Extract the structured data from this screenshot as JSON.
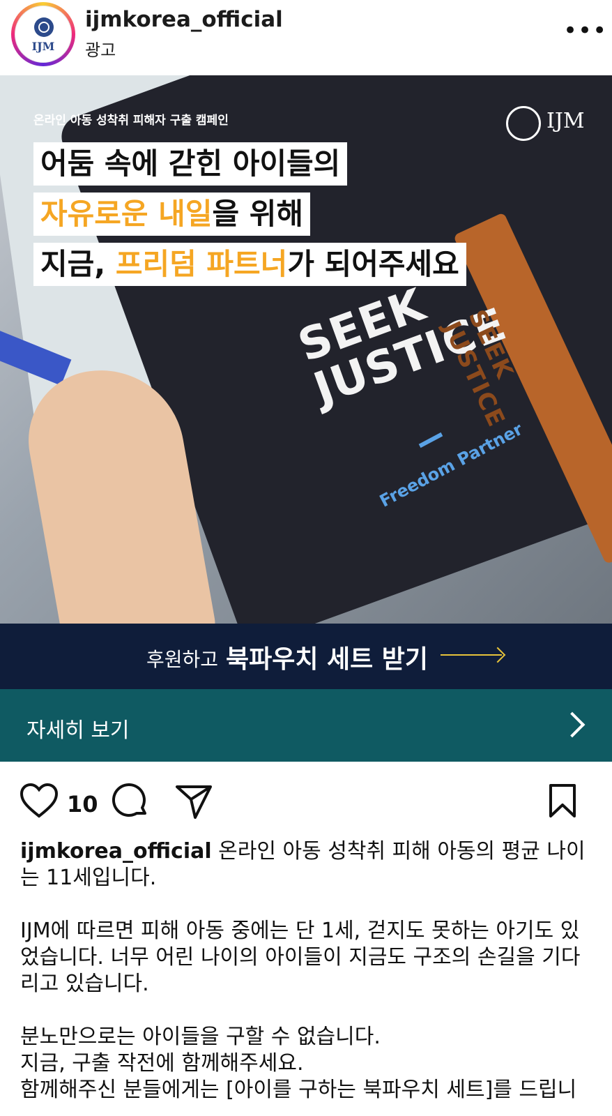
{
  "header": {
    "avatar_text": "IJM",
    "username": "ijmkorea_official",
    "sponsored": "광고",
    "more_icon": "more-horizontal-icon"
  },
  "hero": {
    "campaign_label": "온라인 아동 성착취 피해자 구출 캠페인",
    "logo_text": "IJM",
    "line1": "어둠 속에 갇힌 아이들의",
    "line2_highlight": "자유로운 내일",
    "line2_rest": "을 위해",
    "line3_pre": "지금, ",
    "line3_highlight": "프리덤 파트너",
    "line3_rest": "가 되어주세요",
    "pouch_text_1": "SEEK",
    "pouch_text_2": "JUSTICE",
    "pouch_sub": "Freedom Partner",
    "strap_text": "SEEK JUSTICE",
    "highlight_color": "#f5a623"
  },
  "cta": {
    "small": "후원하고",
    "big": "북파우치 세트 받기"
  },
  "more_bar": {
    "label": "자세히 보기"
  },
  "actions": {
    "like_count": "10"
  },
  "caption": {
    "username": "ijmkorea_official",
    "para1_text": " 온라인 아동 성착취 피해 아동의 평균 나이는 11세입니다.",
    "para2": "IJM에 따르면 피해 아동 중에는 단 1세, 걷지도 못하는 아기도 있었습니다. 너무 어린 나이의 아이들이 지금도 구조의 손길을 기다리고 있습니다.",
    "para3_line1": "분노만으로는 아이들을 구할 수 없습니다.",
    "para3_line2": "지금, 구출 작전에 함께해주세요.",
    "para3_line3": "함께해주신 분들에게는 [아이를 구하는 북파우치 세트]를 드립니"
  }
}
